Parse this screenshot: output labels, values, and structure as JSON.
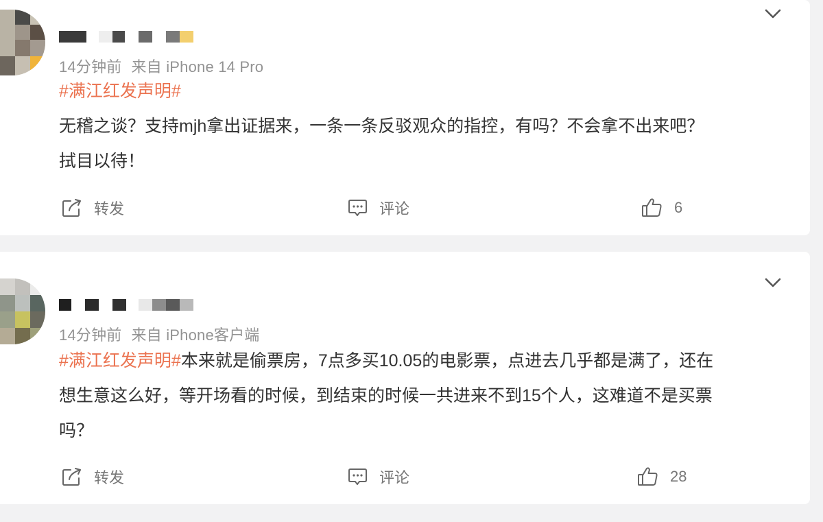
{
  "colors": {
    "background": "#f2f2f3",
    "card": "#ffffff",
    "hashtag": "#eb7350",
    "text": "#333333",
    "meta": "#939393",
    "action": "#777777"
  },
  "posts": [
    {
      "time": "14分钟前",
      "source": "来自 iPhone 14 Pro",
      "hashtag": "#满江红发声明#",
      "lines": [
        "无稽之谈？支持mjh拿出证据来，一条一条反驳观众的指控，有吗？不会拿不出来吧？",
        "拭目以待！"
      ],
      "actions": {
        "repost": "转发",
        "comment": "评论",
        "likes": "6"
      },
      "icons": {
        "repost": "share-icon",
        "comment": "comment-icon",
        "like": "thumbs-up-icon",
        "collapse": "chevron-down-icon"
      }
    },
    {
      "time": "14分钟前",
      "source": "来自 iPhone客户端",
      "hashtag": "#满江红发声明#",
      "lines": [
        "本来就是偷票房，7点多买10.05的电影票，点进去几乎都是满了，还在",
        "想生意这么好，等开场看的时候，到结束的时候一共进来不到15个人，这难道不是买票",
        "吗？"
      ],
      "actions": {
        "repost": "转发",
        "comment": "评论",
        "likes": "28"
      },
      "icons": {
        "repost": "share-icon",
        "comment": "comment-icon",
        "like": "thumbs-up-icon",
        "collapse": "chevron-down-icon"
      }
    }
  ]
}
